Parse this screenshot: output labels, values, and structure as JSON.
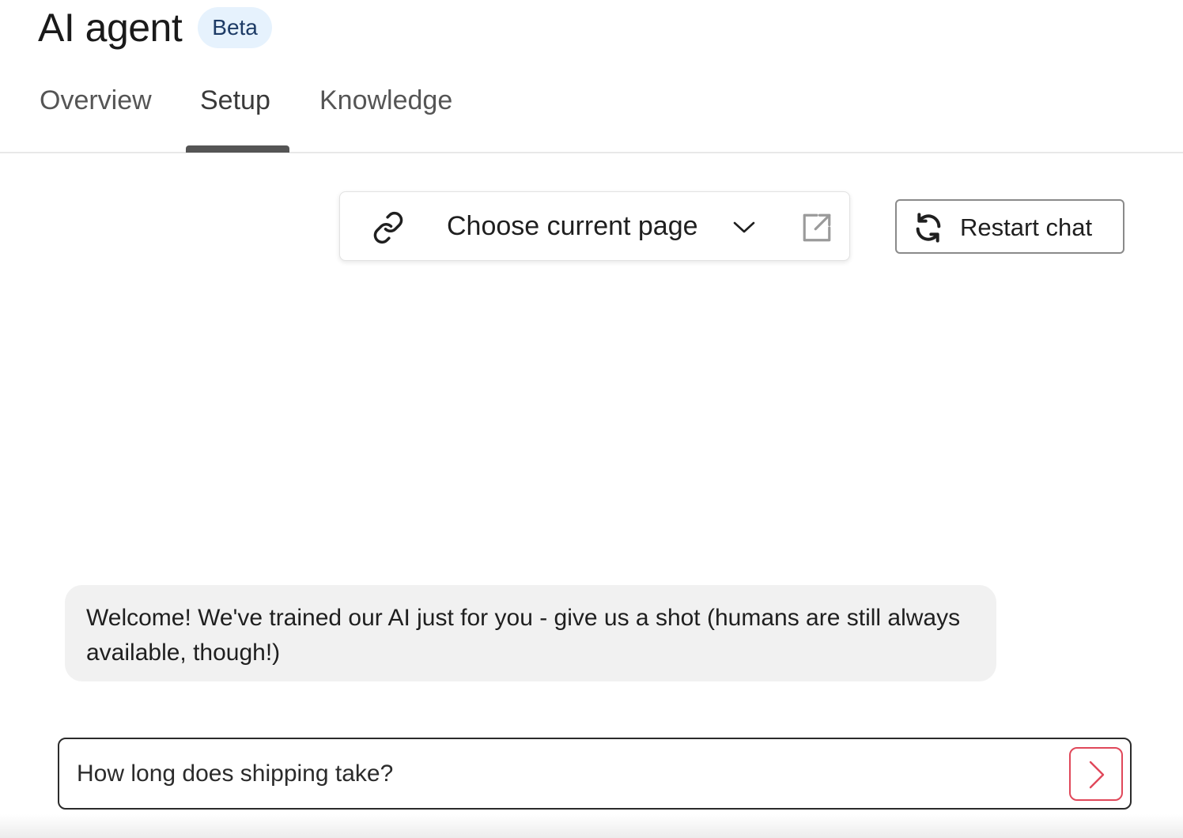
{
  "header": {
    "title": "AI agent",
    "badge": "Beta"
  },
  "tabs": [
    {
      "label": "Overview",
      "active": false
    },
    {
      "label": "Setup",
      "active": true
    },
    {
      "label": "Knowledge",
      "active": false
    }
  ],
  "page_chooser": {
    "label": "Choose current page",
    "icons": {
      "left": "link-icon",
      "dropdown": "chevron-down-icon",
      "right": "external-link-icon"
    }
  },
  "restart": {
    "label": "Restart chat",
    "icon": "refresh-icon"
  },
  "chat": {
    "welcome_message": "Welcome! We've trained our AI just for you - give us a shot (humans are still always available, though!)"
  },
  "composer": {
    "value": "How long does shipping take?",
    "send_icon": "chevron-right-icon"
  },
  "colors": {
    "badge_bg": "#e6f2fd",
    "badge_text": "#1d3b66",
    "tab_indicator": "#555555",
    "send_accent": "#e0485a",
    "bubble_bg": "#f1f1f1"
  }
}
